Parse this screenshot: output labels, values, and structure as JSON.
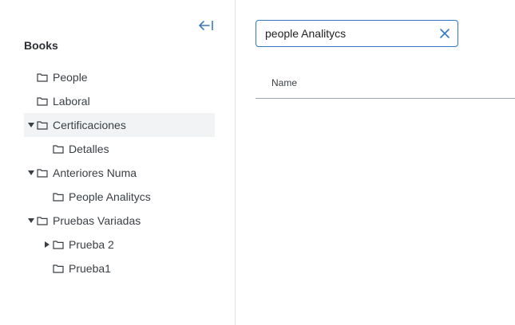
{
  "sidebar": {
    "title": "Books",
    "tree": [
      {
        "label": "People",
        "level": 0,
        "caret": "none"
      },
      {
        "label": "Laboral",
        "level": 0,
        "caret": "none"
      },
      {
        "label": "Certificaciones",
        "level": 0,
        "caret": "down",
        "selected": true
      },
      {
        "label": "Detalles",
        "level": 1,
        "caret": "none"
      },
      {
        "label": "Anteriores Numa",
        "level": 0,
        "caret": "down"
      },
      {
        "label": "People Analitycs",
        "level": 1,
        "caret": "none"
      },
      {
        "label": "Pruebas Variadas",
        "level": 0,
        "caret": "down"
      },
      {
        "label": "Prueba 2",
        "level": 1,
        "caret": "right"
      },
      {
        "label": "Prueba1",
        "level": 1,
        "caret": "none"
      }
    ]
  },
  "search": {
    "value": "people Analitycs"
  },
  "table": {
    "columns": [
      "Name"
    ]
  },
  "colors": {
    "accent": "#2f77c9",
    "selected_bg": "#f1f3f5"
  }
}
